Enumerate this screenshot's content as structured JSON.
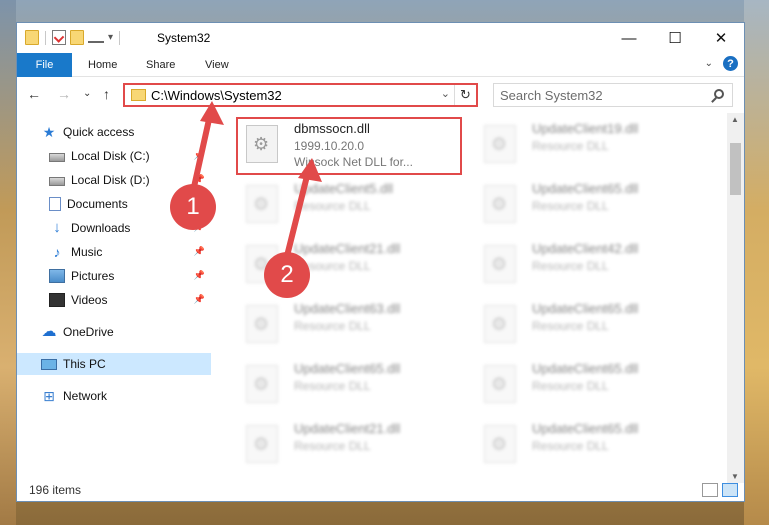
{
  "window": {
    "title": "System32",
    "controls": {
      "minimize": "—",
      "maximize": "☐",
      "close": "✕"
    }
  },
  "ribbon": {
    "tabs": [
      "File",
      "Home",
      "Share",
      "View"
    ],
    "expand": "⌄",
    "help": "?"
  },
  "navbar": {
    "back": "←",
    "forward": "→",
    "recent": "⌄",
    "up": "↑",
    "address": "C:\\Windows\\System32",
    "address_dropdown": "⌄",
    "refresh": "↻",
    "search_placeholder": "Search System32"
  },
  "sidebar": {
    "items": [
      {
        "label": "Quick access",
        "icon": "star-icon"
      },
      {
        "label": "Local Disk (C:)",
        "icon": "drive-icon"
      },
      {
        "label": "Local Disk (D:)",
        "icon": "drive-icon"
      },
      {
        "label": "Documents",
        "icon": "documents-icon"
      },
      {
        "label": "Downloads",
        "icon": "downloads-icon"
      },
      {
        "label": "Music",
        "icon": "music-icon"
      },
      {
        "label": "Pictures",
        "icon": "pictures-icon"
      },
      {
        "label": "Videos",
        "icon": "videos-icon"
      },
      {
        "label": "OneDrive",
        "icon": "onedrive-icon"
      },
      {
        "label": "This PC",
        "icon": "this-pc-icon"
      },
      {
        "label": "Network",
        "icon": "network-icon"
      }
    ],
    "pin": "📌"
  },
  "files": [
    {
      "name": "dbmssocn.dll",
      "line2": "1999.10.20.0",
      "line3": "Winsock Net DLL for..."
    },
    {
      "name": "UpdateClient19.dll",
      "line2": "Resource DLL"
    },
    {
      "name": "UpdateClient5.dll",
      "line2": "Resource DLL"
    },
    {
      "name": "UpdateClient65.dll",
      "line2": "Resource DLL"
    },
    {
      "name": "UpdateClient21.dll",
      "line2": "Resource DLL"
    },
    {
      "name": "UpdateClient42.dll",
      "line2": "Resource DLL"
    },
    {
      "name": "UpdateClient63.dll",
      "line2": "Resource DLL"
    },
    {
      "name": "UpdateClient65.dll",
      "line2": "Resource DLL"
    },
    {
      "name": "UpdateClient65.dll",
      "line2": "Resource DLL"
    },
    {
      "name": "UpdateClient65.dll",
      "line2": "Resource DLL"
    },
    {
      "name": "UpdateClient21.dll",
      "line2": "Resource DLL"
    },
    {
      "name": "UpdateClient65.dll",
      "line2": "Resource DLL"
    }
  ],
  "status": {
    "item_count": "196 items"
  },
  "annotations": {
    "badge1": "1",
    "badge2": "2"
  },
  "colors": {
    "accent": "#1979ca",
    "highlight": "#e14a4a",
    "selection": "#cce8ff"
  }
}
